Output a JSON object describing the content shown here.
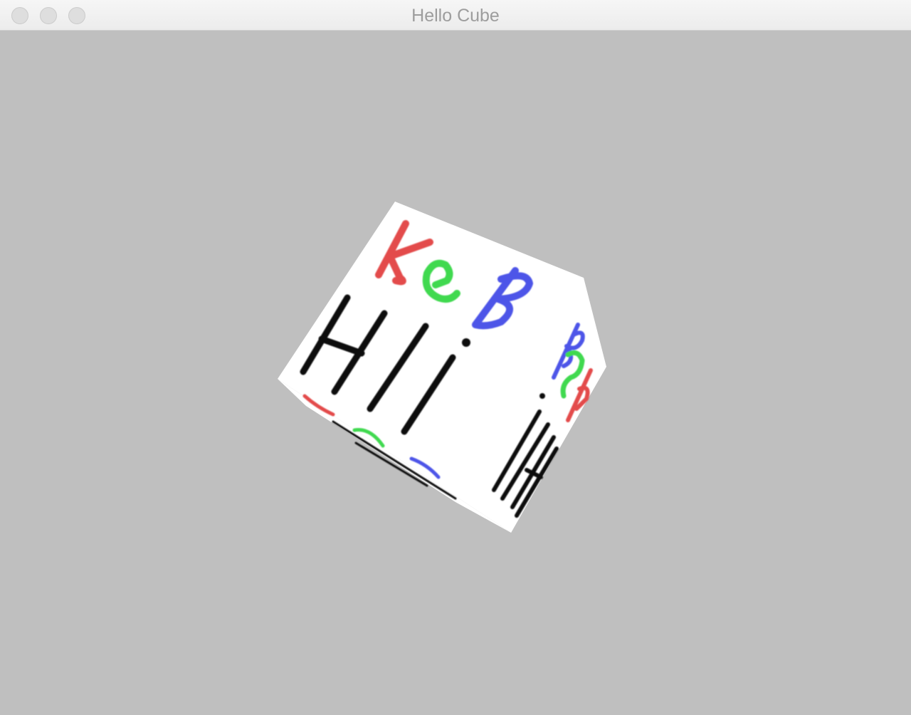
{
  "window": {
    "title": "Hello Cube"
  },
  "cube": {
    "face_text": "Hi",
    "face_text_secondary": "KeB",
    "glyph_colors": {
      "K": "#e34b4b",
      "e": "#3fd94f",
      "B": "#4d55e8",
      "Hi": "#111111"
    },
    "face_color": "#ffffff",
    "background_color": "#bfbfbf"
  },
  "icons": {
    "close": "close-traffic-light-icon",
    "minimize": "minimize-traffic-light-icon",
    "zoom": "zoom-traffic-light-icon"
  }
}
